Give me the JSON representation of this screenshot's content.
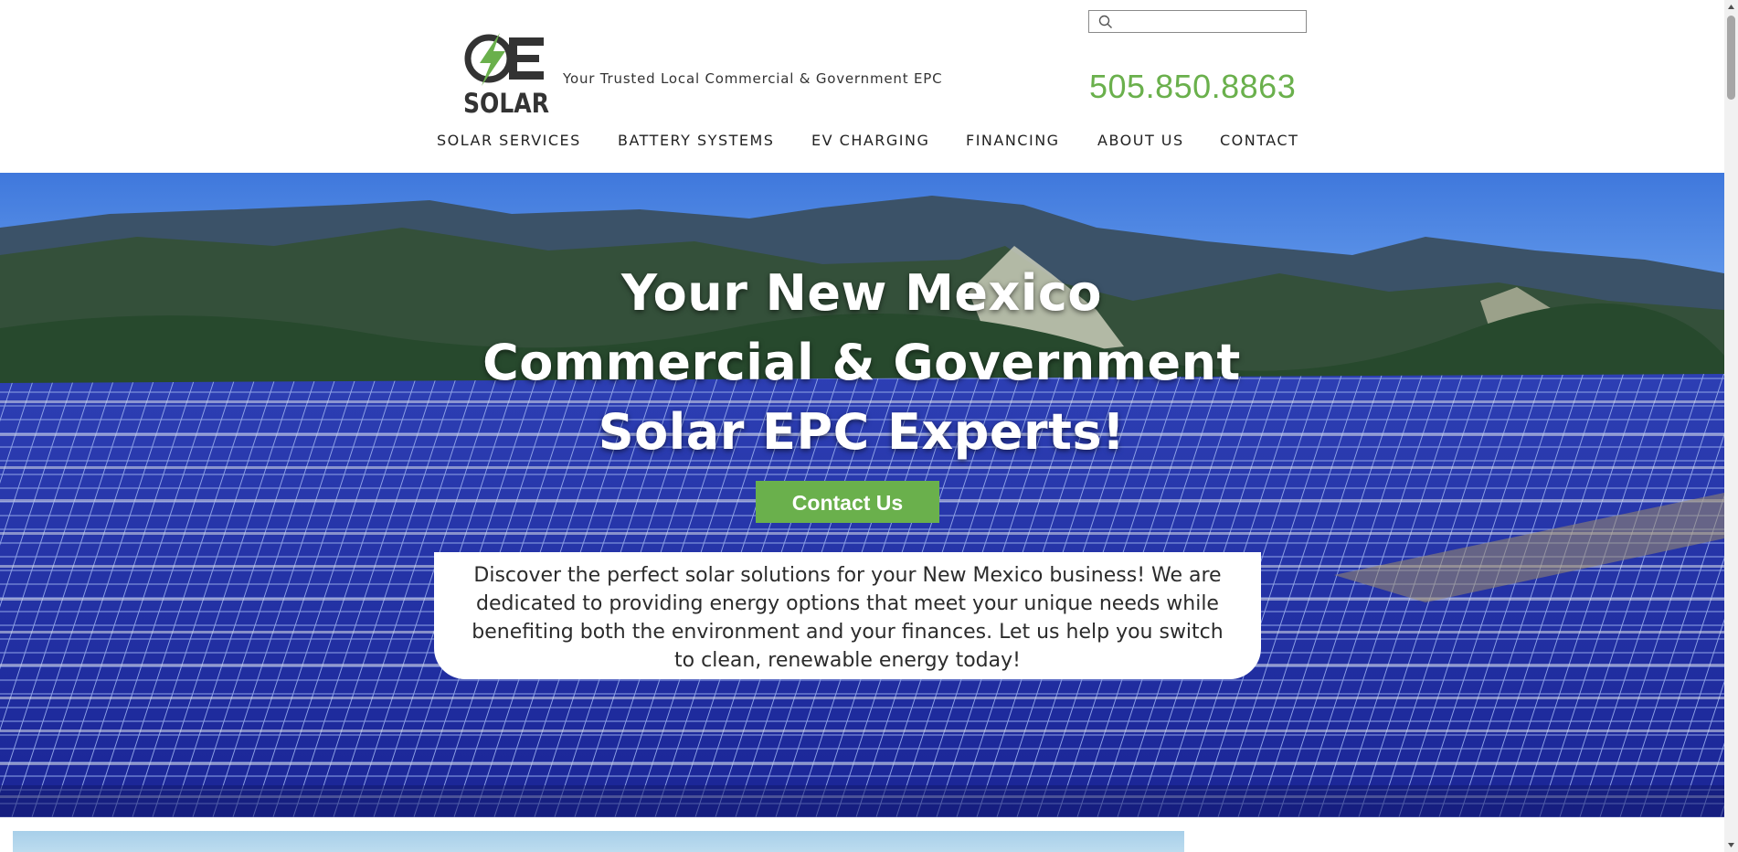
{
  "header": {
    "logo_text": "OE SOLAR",
    "tagline": "Your Trusted Local Commercial & Government EPC",
    "phone": "505.850.8863",
    "search": {
      "placeholder": "",
      "value": ""
    }
  },
  "nav": {
    "items": [
      {
        "label": "SOLAR SERVICES"
      },
      {
        "label": "BATTERY SYSTEMS"
      },
      {
        "label": "EV CHARGING"
      },
      {
        "label": "FINANCING"
      },
      {
        "label": "ABOUT US"
      },
      {
        "label": "CONTACT"
      }
    ]
  },
  "hero": {
    "title_lines": [
      "Your New Mexico",
      "Commercial & Government",
      "Solar EPC Experts!"
    ],
    "cta_label": "Contact Us",
    "intro": "Discover the perfect solar solutions for your New Mexico business! We are dedicated to providing energy options that meet your unique needs while benefiting both the environment and your finances. Let us help you switch to clean, renewable energy today!"
  },
  "colors": {
    "accent_green": "#6ab04c",
    "text_dark": "#222222",
    "panel_blue": "#1e2a8c"
  },
  "icons": [
    "lightning-bolt-icon",
    "search-icon",
    "scroll-up-icon",
    "scroll-down-icon"
  ]
}
